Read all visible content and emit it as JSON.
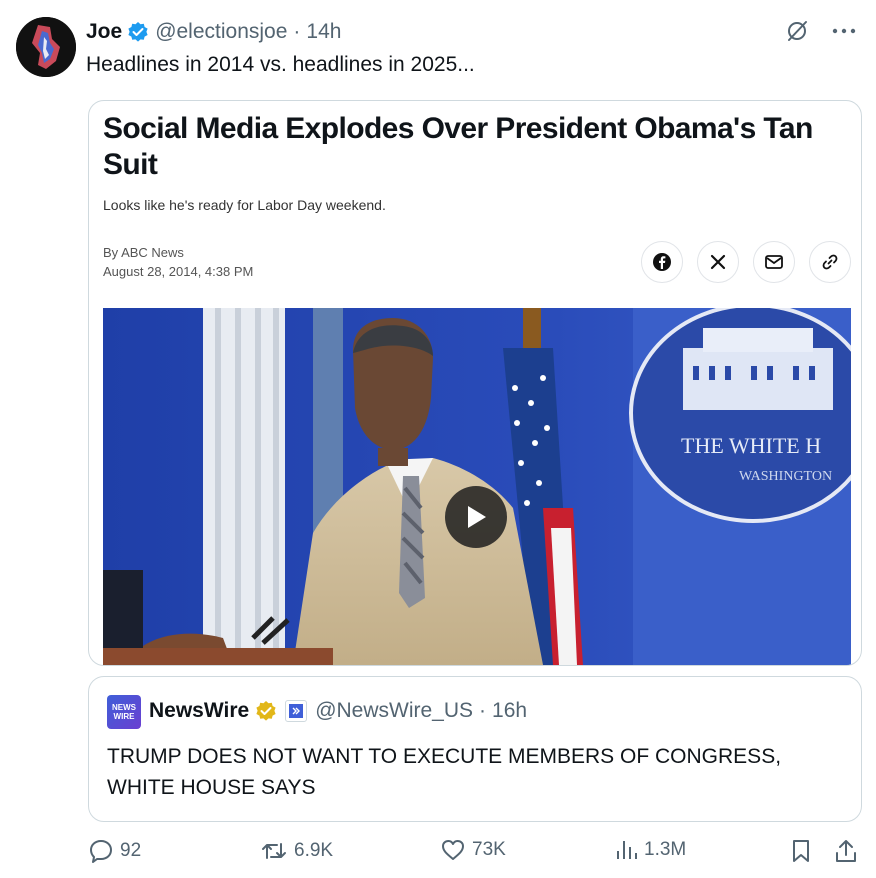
{
  "tweet": {
    "display_name": "Joe",
    "handle": "@electionsjoe",
    "separator": "·",
    "time": "14h",
    "text": "Headlines in 2014 vs. headlines in 2025..."
  },
  "article": {
    "headline": "Social Media Explodes Over President Obama's Tan Suit",
    "subhead": "Looks like he's ready for Labor Day weekend.",
    "byline": "By ABC News",
    "date": "August 28, 2014, 4:38 PM",
    "share_icons": [
      "facebook-icon",
      "x-icon",
      "mail-icon",
      "link-icon"
    ],
    "photo_sign_line1": "THE WHITE H",
    "photo_sign_line2": "WASHINGTON"
  },
  "quote": {
    "logo_text_line1": "NEWS",
    "logo_text_line2": "WIRE",
    "display_name": "NewsWire",
    "handle": "@NewsWire_US",
    "separator": "·",
    "time": "16h",
    "text": "TRUMP DOES NOT WANT TO EXECUTE MEMBERS OF CONGRESS, WHITE HOUSE SAYS"
  },
  "actions": {
    "replies": "92",
    "reposts": "6.9K",
    "likes": "73K",
    "views": "1.3M"
  },
  "colors": {
    "accent": "#1d9bf0",
    "muted": "#536471",
    "border": "#cfd9de",
    "gold_badge": "#e2b719"
  }
}
